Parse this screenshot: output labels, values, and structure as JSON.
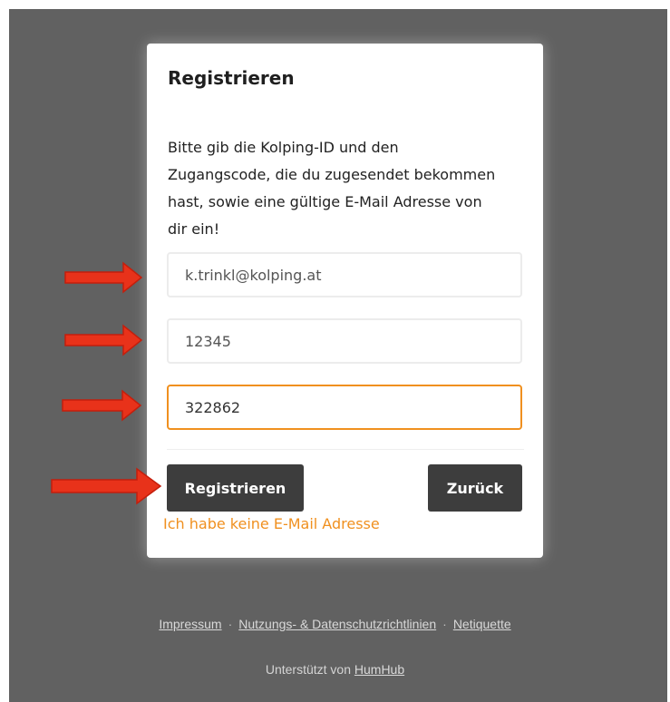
{
  "colors": {
    "accent": "#f0901f",
    "arrow": "#e8321a",
    "button": "#3d3d3d",
    "backdrop": "#616161"
  },
  "card": {
    "title": "Registrieren",
    "text_lines": [
      "Bitte gib die Kolping-ID und den",
      "Zugangscode, die du zugesendet bekommen",
      "hast, sowie eine gültige E-Mail Adresse von",
      "dir ein!"
    ],
    "fields": [
      {
        "value": "k.trinkl@kolping.at"
      },
      {
        "value": "12345"
      },
      {
        "value": "322862"
      }
    ],
    "register_label": "Registrieren",
    "back_label": "Zurück",
    "no_email_link": "Ich habe keine E-Mail Adresse"
  },
  "footer": {
    "links": [
      "Impressum",
      "Nutzungs- & Datenschutzrichtlinien",
      "Netiquette"
    ],
    "separator": "·",
    "powered_by_prefix": "Unterstützt von",
    "powered_by_link": "HumHub"
  }
}
